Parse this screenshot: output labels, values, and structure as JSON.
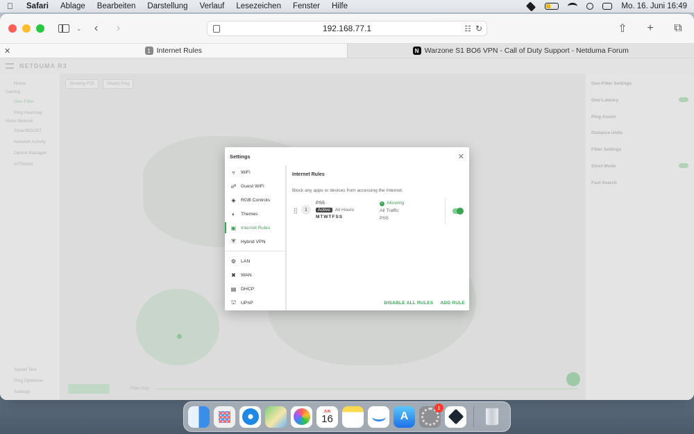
{
  "menubar": {
    "app_name": "Safari",
    "items": [
      "Ablage",
      "Bearbeiten",
      "Darstellung",
      "Verlauf",
      "Lesezeichen",
      "Fenster",
      "Hilfe"
    ],
    "clock": "Mo. 16. Juni  16:49"
  },
  "browser": {
    "address": "192.168.77.1",
    "tabs": [
      {
        "favicon": "1",
        "title": "Internet Rules"
      },
      {
        "favicon": "N",
        "title": "Warzone S1 BO6 VPN - Call of Duty Support - Netduma Forum"
      }
    ]
  },
  "settings_modal": {
    "title": "Settings",
    "nav": {
      "group1": [
        {
          "label": "WiFi",
          "icon": "wifi-icon"
        },
        {
          "label": "Guest WiFi",
          "icon": "guest-wifi-icon"
        },
        {
          "label": "RGB Controls",
          "icon": "rgb-icon"
        },
        {
          "label": "Themes",
          "icon": "palette-icon"
        },
        {
          "label": "Internet Rules",
          "icon": "rules-icon",
          "active": true
        },
        {
          "label": "Hybrid VPN",
          "icon": "shield-icon"
        }
      ],
      "group2": [
        {
          "label": "LAN",
          "icon": "lan-icon"
        },
        {
          "label": "WAN",
          "icon": "wan-icon"
        },
        {
          "label": "DHCP",
          "icon": "dhcp-icon"
        },
        {
          "label": "UPnP",
          "icon": "upnp-icon"
        }
      ]
    },
    "body": {
      "title": "Internet Rules",
      "description": "Block any apps or devices from accessing the Internet.",
      "rule": {
        "number": "1",
        "device": "PS5",
        "status": "Active",
        "hours": "All Hours",
        "days": "MTWTFSS",
        "action": "Allowing",
        "traffic": "All Traffic",
        "target": "PS5",
        "enabled": true
      },
      "actions": {
        "disable_all": "DISABLE ALL RULES",
        "add": "ADD RULE"
      }
    }
  },
  "dock": {
    "calendar_month": "JUN",
    "calendar_day": "16",
    "settings_badge": "1"
  },
  "colors": {
    "accent_green": "#3aa655",
    "toggle_track": "#7fcc95"
  }
}
